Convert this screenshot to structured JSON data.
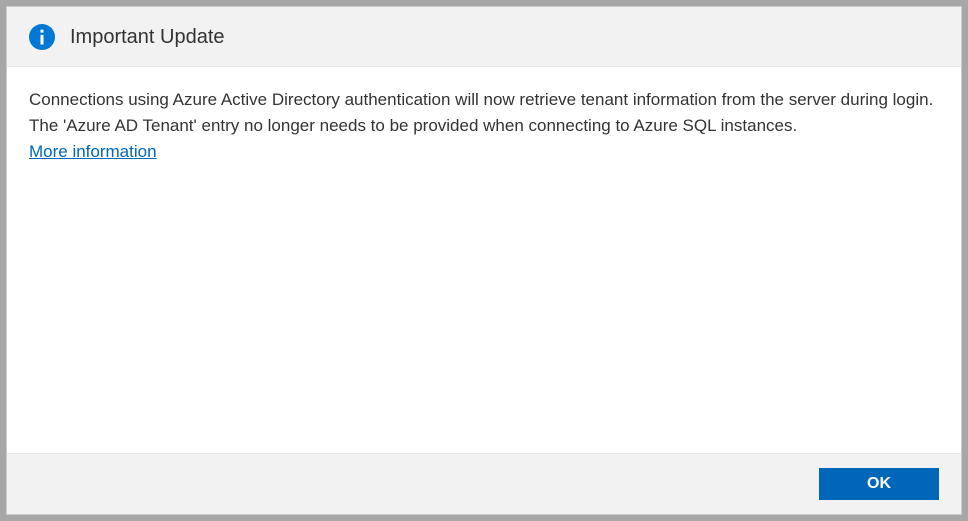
{
  "dialog": {
    "title": "Important Update",
    "message": "Connections using Azure Active Directory authentication will now retrieve tenant information from the server during login. The 'Azure AD Tenant' entry no longer needs to be provided when connecting to Azure SQL instances.",
    "link_label": "More information",
    "ok_label": "OK"
  }
}
